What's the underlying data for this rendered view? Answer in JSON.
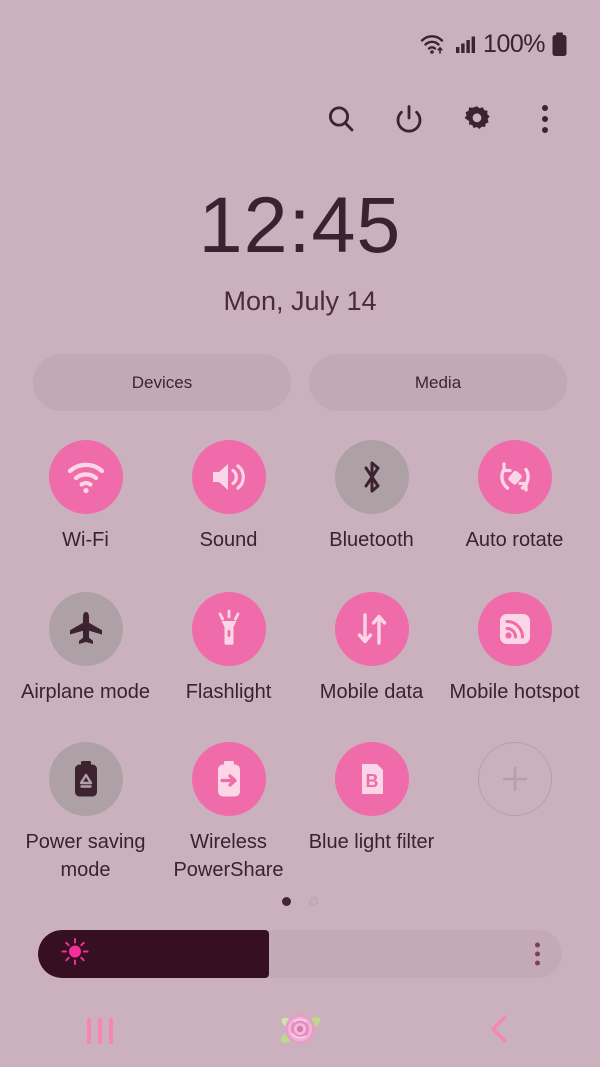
{
  "status_bar": {
    "wifi_icon": "wifi-data-icon",
    "signal_icon": "cellular-signal-icon",
    "battery_percent": "100%",
    "battery_icon": "battery-full-icon"
  },
  "header": {
    "search_icon": "search-icon",
    "power_icon": "power-icon",
    "settings_icon": "gear-icon",
    "more_icon": "more-vertical-icon"
  },
  "clock": {
    "time": "12:45",
    "date": "Mon, July 14"
  },
  "pills": [
    {
      "label": "Devices",
      "name": "devices-pill"
    },
    {
      "label": "Media",
      "name": "media-pill"
    }
  ],
  "tiles": [
    {
      "label": "Wi-Fi",
      "icon": "wifi-icon",
      "state": "on"
    },
    {
      "label": "Sound",
      "icon": "speaker-icon",
      "state": "on"
    },
    {
      "label": "Bluetooth",
      "icon": "bluetooth-icon",
      "state": "off"
    },
    {
      "label": "Auto rotate",
      "icon": "auto-rotate-icon",
      "state": "on"
    },
    {
      "label": "Airplane mode",
      "icon": "airplane-icon",
      "state": "off"
    },
    {
      "label": "Flashlight",
      "icon": "flashlight-icon",
      "state": "on"
    },
    {
      "label": "Mobile data",
      "icon": "mobile-data-icon",
      "state": "on"
    },
    {
      "label": "Mobile hotspot",
      "icon": "hotspot-icon",
      "state": "on"
    },
    {
      "label": "Power saving mode",
      "icon": "battery-saver-icon",
      "state": "off"
    },
    {
      "label": "Wireless PowerShare",
      "icon": "powershare-icon",
      "state": "on"
    },
    {
      "label": "Blue light filter",
      "icon": "blue-light-filter-icon",
      "state": "on"
    },
    {
      "label": "",
      "icon": "add-icon",
      "state": "add"
    }
  ],
  "pagination": {
    "total": 2,
    "current": 1
  },
  "brightness": {
    "value_percent": 44,
    "sun_icon": "brightness-sun-icon",
    "menu_icon": "more-vertical-icon"
  },
  "navbar": {
    "recents_icon": "recents-icon",
    "home_icon": "rose-home-icon",
    "back_icon": "back-chevron-icon"
  },
  "colors": {
    "background": "#cbb0be",
    "accent_pink": "#f06baa",
    "inactive_gray": "#aea1a6",
    "text_dark": "#3c2130",
    "slider_fill": "#360f22",
    "nav_pink": "#f985b7"
  }
}
